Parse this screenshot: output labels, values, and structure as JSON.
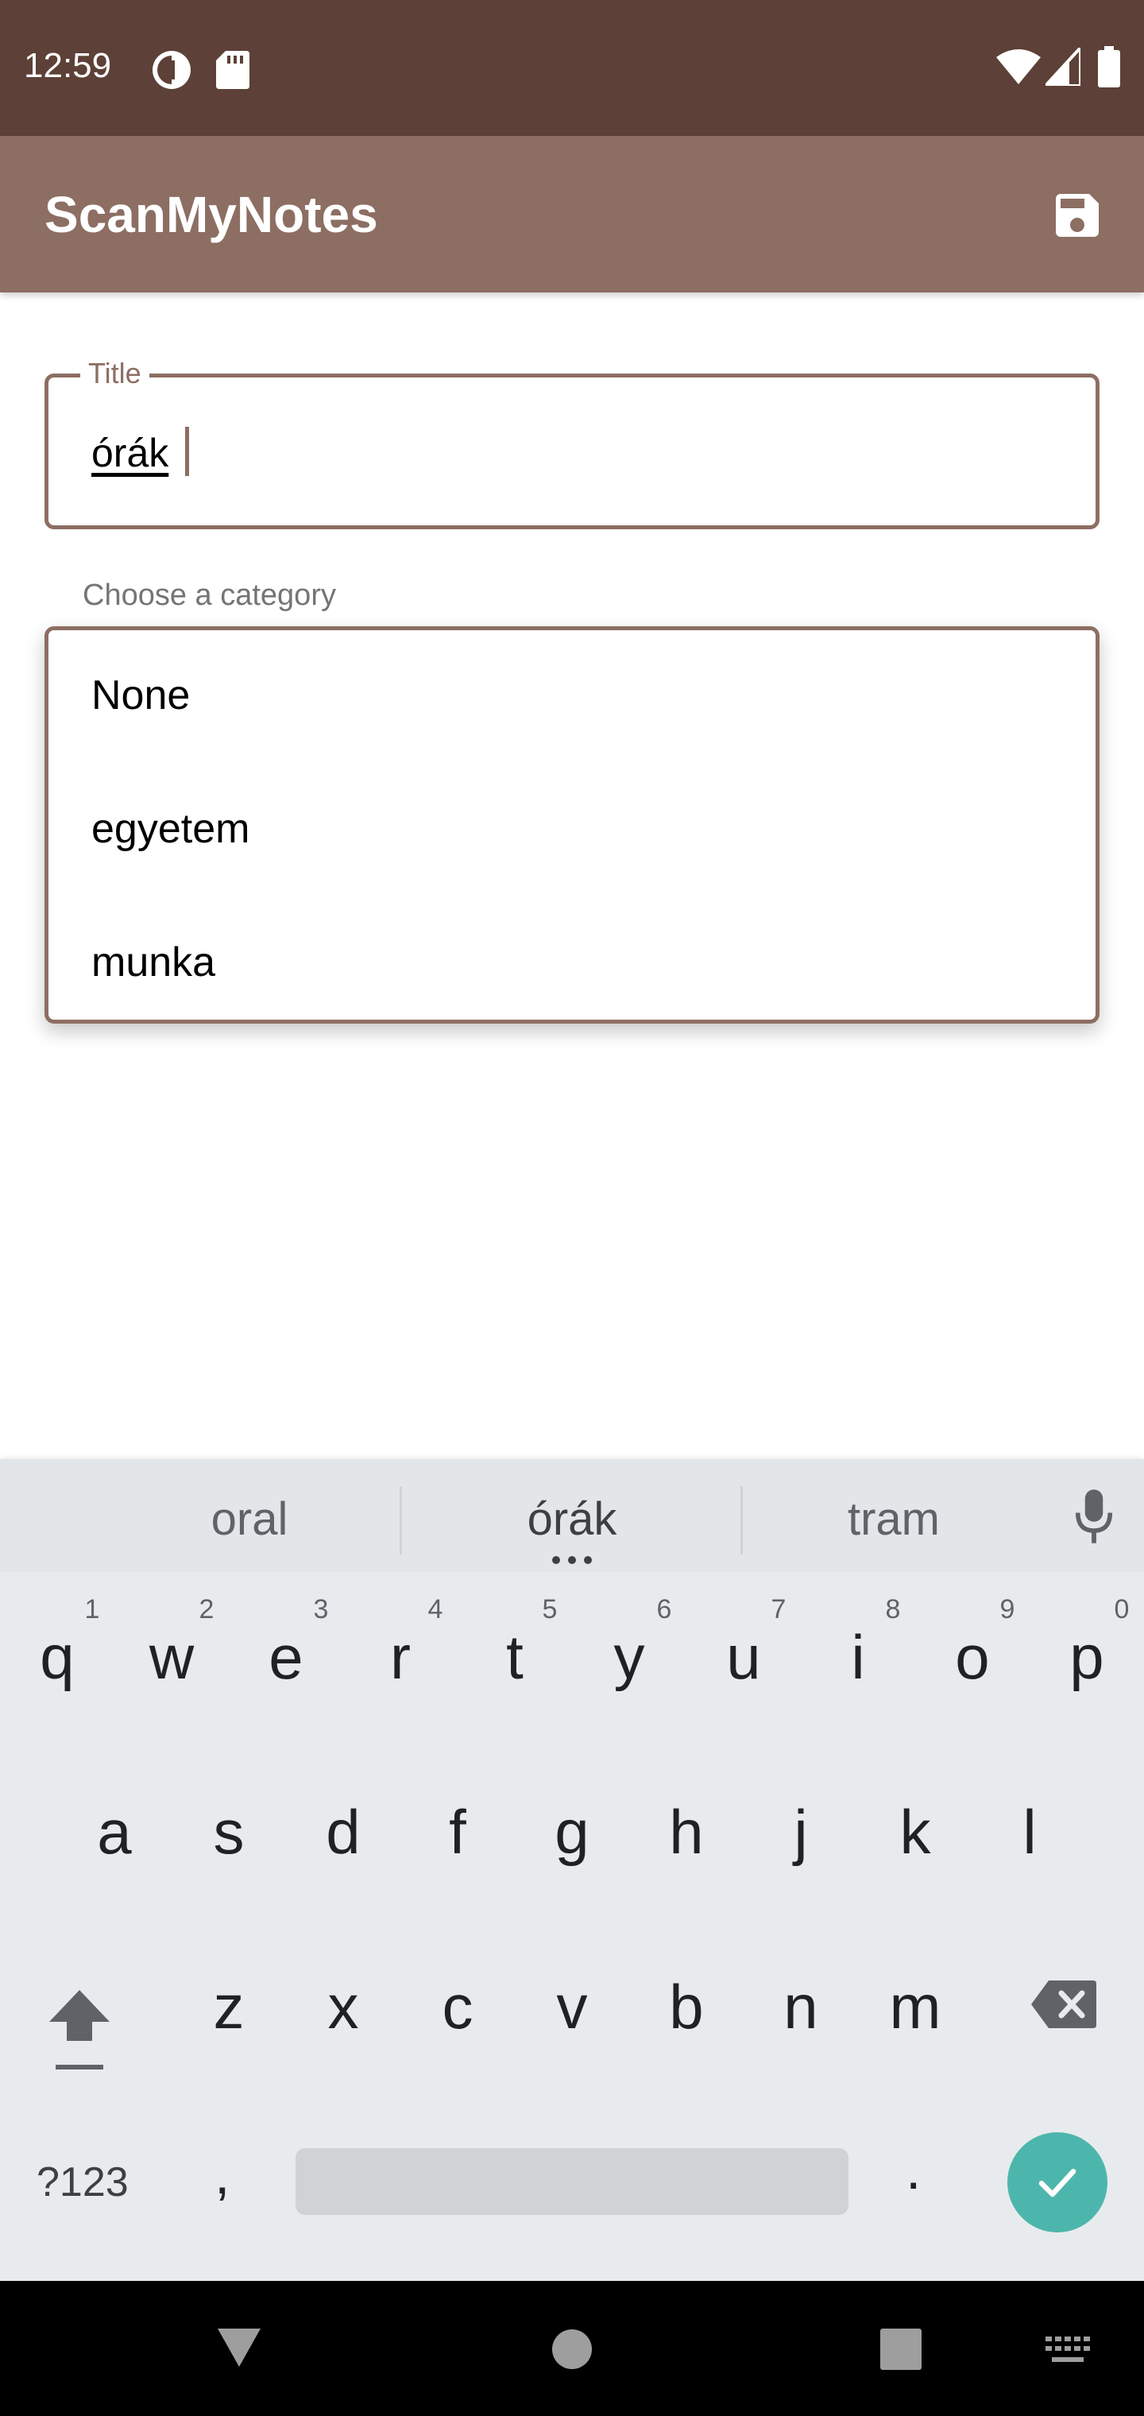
{
  "status_bar": {
    "time": "12:59",
    "left_icons": [
      "data-saver-icon",
      "sd-card-icon"
    ],
    "right_icons": [
      "wifi-icon",
      "signal-icon",
      "battery-icon"
    ]
  },
  "app_bar": {
    "title": "ScanMyNotes",
    "action_icon": "save-icon",
    "color": "#8d6e63"
  },
  "form": {
    "title_label": "Title",
    "title_value": "órák",
    "category_label": "Choose a category",
    "category_options": [
      "None",
      "egyetem",
      "munka"
    ]
  },
  "keyboard": {
    "suggestions": [
      "oral",
      "órák",
      "tram"
    ],
    "row1": [
      "q",
      "w",
      "e",
      "r",
      "t",
      "y",
      "u",
      "i",
      "o",
      "p"
    ],
    "row1_hints": [
      "1",
      "2",
      "3",
      "4",
      "5",
      "6",
      "7",
      "8",
      "9",
      "0"
    ],
    "row2": [
      "a",
      "s",
      "d",
      "f",
      "g",
      "h",
      "j",
      "k",
      "l"
    ],
    "row3": [
      "z",
      "x",
      "c",
      "v",
      "b",
      "n",
      "m"
    ],
    "symbols_key": "?123",
    "comma": ",",
    "period": ".",
    "accent_color": "#4db6ac"
  },
  "nav_bar": {
    "icons": [
      "back-icon",
      "home-icon",
      "recents-icon",
      "keyboard-switch-icon"
    ]
  }
}
